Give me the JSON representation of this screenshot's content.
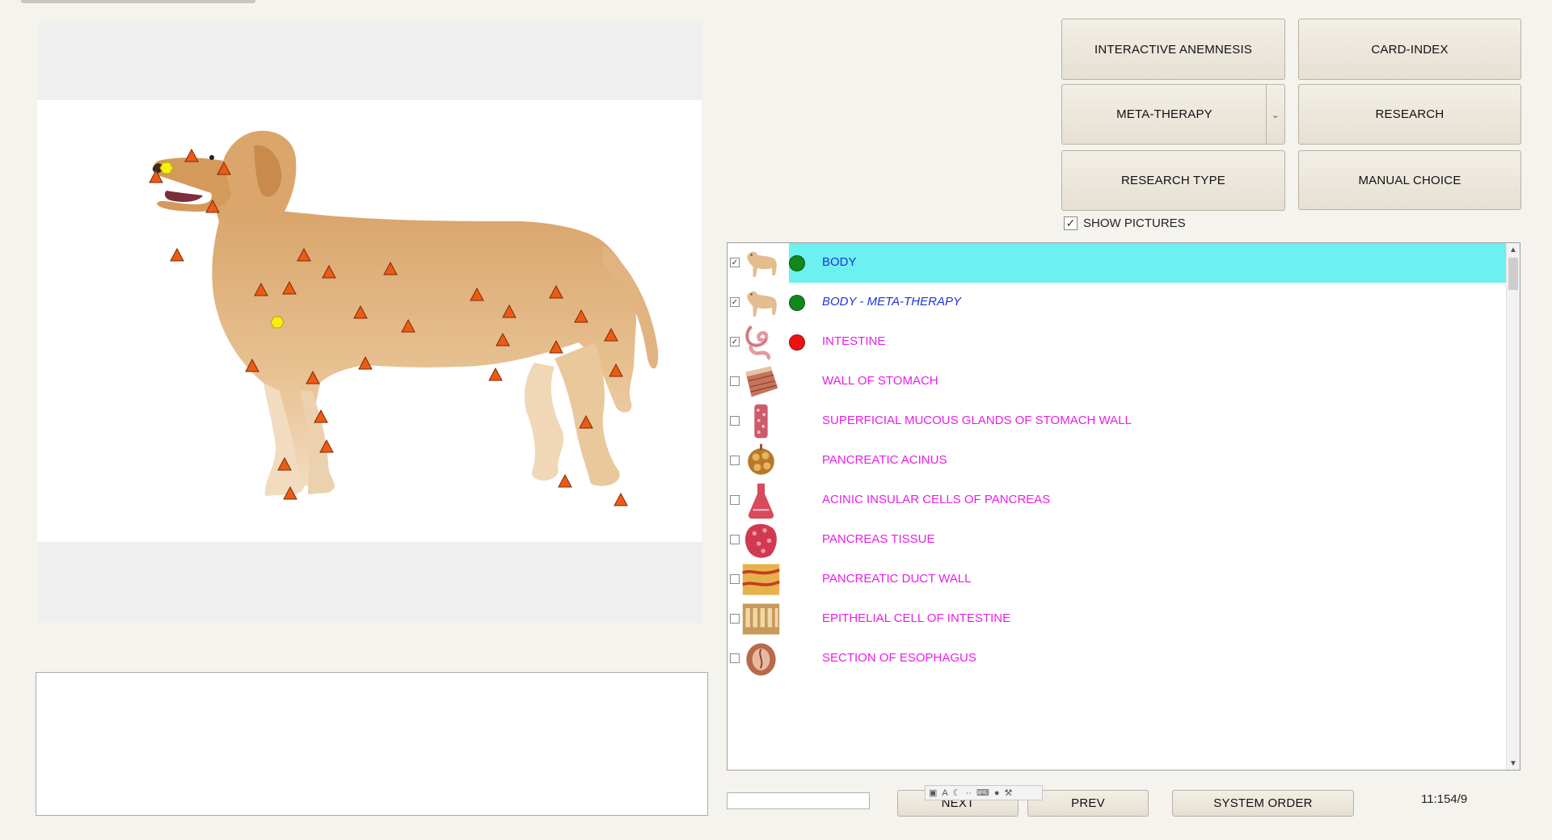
{
  "buttons": {
    "interactive_anemnesis": "INTERACTIVE ANEMNESIS",
    "card_index": "CARD-INDEX",
    "meta_therapy": "META-THERAPY",
    "research": "RESEARCH",
    "research_type": "RESEARCH TYPE",
    "manual_choice": "MANUAL CHOICE",
    "next": "NEXT",
    "prev": "PREV",
    "system_order": "SYSTEM ORDER"
  },
  "show_pictures": {
    "label": "SHOW PICTURES",
    "checked": true
  },
  "list": [
    {
      "label": "BODY",
      "checked": true,
      "status": "green",
      "color": "#1f33d6",
      "italic": false,
      "selected": true,
      "thumb": "dog"
    },
    {
      "label": "BODY - META-THERAPY",
      "checked": true,
      "status": "green",
      "color": "#1f33d6",
      "italic": true,
      "selected": false,
      "thumb": "dog"
    },
    {
      "label": "INTESTINE",
      "checked": true,
      "status": "red",
      "color": "#e81ee8",
      "italic": false,
      "selected": false,
      "thumb": "intestine"
    },
    {
      "label": "WALL OF STOMACH",
      "checked": false,
      "status": null,
      "color": "#e81ee8",
      "italic": false,
      "selected": false,
      "thumb": "tissue"
    },
    {
      "label": "SUPERFICIAL MUCOUS GLANDS OF STOMACH WALL",
      "checked": false,
      "status": null,
      "color": "#e81ee8",
      "italic": false,
      "selected": false,
      "thumb": "gland"
    },
    {
      "label": "PANCREATIC ACINUS",
      "checked": false,
      "status": null,
      "color": "#e81ee8",
      "italic": false,
      "selected": false,
      "thumb": "acinus"
    },
    {
      "label": "ACINIC INSULAR CELLS OF PANCREAS",
      "checked": false,
      "status": null,
      "color": "#e81ee8",
      "italic": false,
      "selected": false,
      "thumb": "flask"
    },
    {
      "label": "PANCREAS  TISSUE",
      "checked": false,
      "status": null,
      "color": "#e81ee8",
      "italic": false,
      "selected": false,
      "thumb": "blob"
    },
    {
      "label": "PANCREATIC DUCT WALL",
      "checked": false,
      "status": null,
      "color": "#e81ee8",
      "italic": false,
      "selected": false,
      "thumb": "duct"
    },
    {
      "label": "EPITHELIAL CELL OF INTESTINE",
      "checked": false,
      "status": null,
      "color": "#e81ee8",
      "italic": false,
      "selected": false,
      "thumb": "epithelial"
    },
    {
      "label": "SECTION OF ESOPHAGUS",
      "checked": false,
      "status": null,
      "color": "#e81ee8",
      "italic": false,
      "selected": false,
      "thumb": "esophagus"
    }
  ],
  "status_colors": {
    "green": "#11881a",
    "red": "#ee1111"
  },
  "counter": "11:154/9",
  "markers": {
    "triangle_count": 31,
    "hexagon_count": 2,
    "triangle_color": "#ee5a14",
    "hexagon_color": "#f7ef10"
  }
}
